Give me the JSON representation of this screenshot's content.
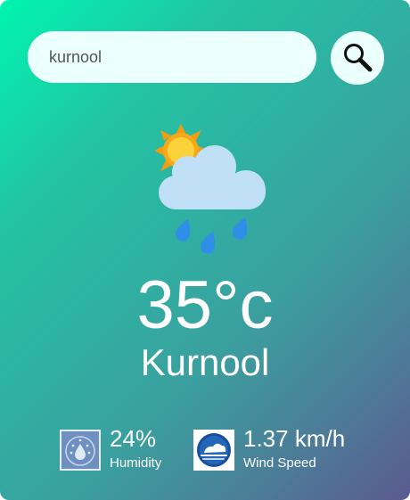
{
  "search": {
    "value": "kurnool",
    "icon": "magnifier-icon"
  },
  "weather": {
    "icon": "sun-cloud-rain-icon",
    "temperature": "35°c",
    "city": "Kurnool"
  },
  "details": {
    "humidity": {
      "value": "24%",
      "label": "Humidity",
      "icon": "humidity-icon"
    },
    "wind": {
      "value": "1.37 km/h",
      "label": "Wind Speed",
      "icon": "wind-icon"
    }
  },
  "colors": {
    "gradient_start": "#00f5b0",
    "gradient_end": "#5b5a90",
    "input_bg": "#ebfffc"
  }
}
